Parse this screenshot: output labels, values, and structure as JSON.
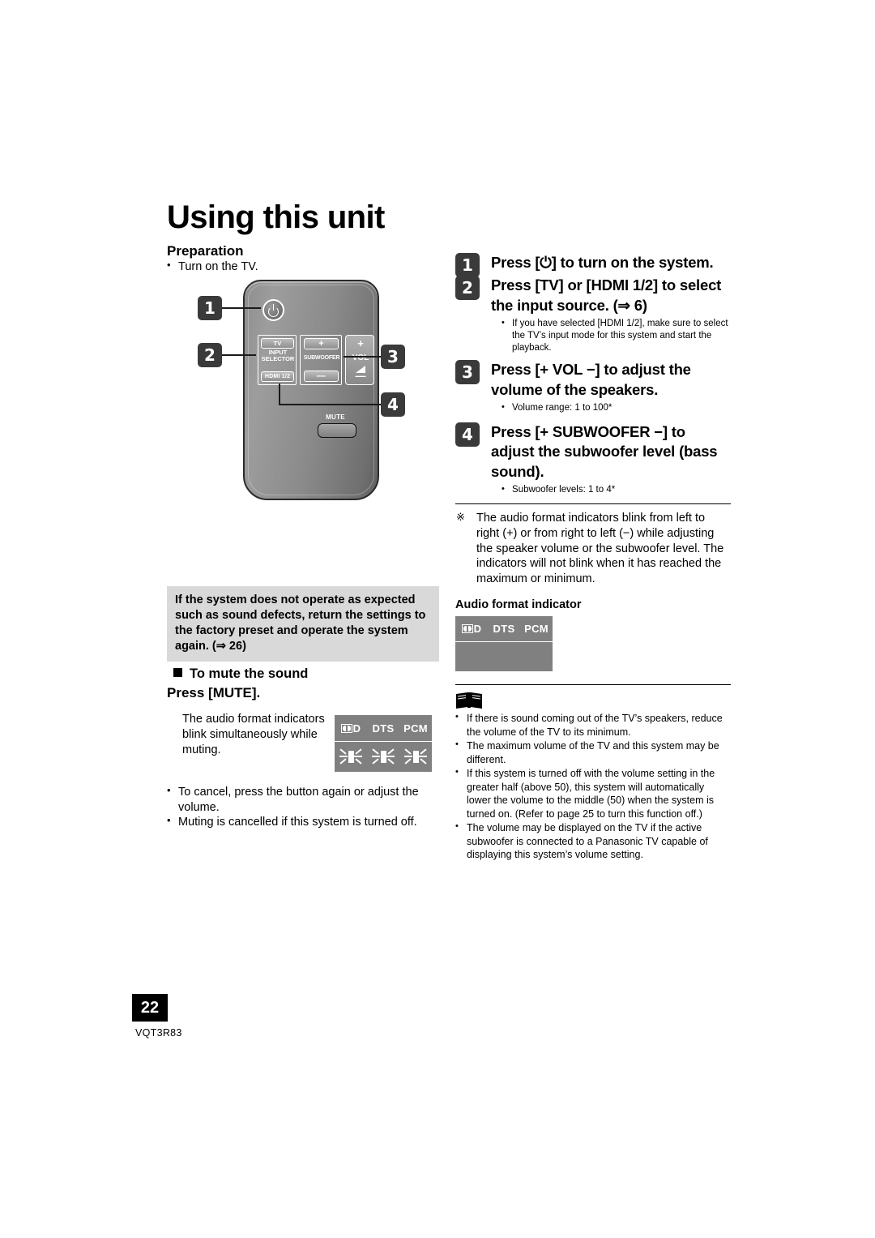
{
  "page": {
    "title": "Using this unit",
    "page_number": "22",
    "doc_code": "VQT3R83"
  },
  "left": {
    "preparation_heading": "Preparation",
    "preparation_bullet": "Turn on the TV.",
    "notice_box": "If the system does not operate as expected such as sound defects, return the settings to the factory preset and operate the system again. (⇒ 26)",
    "mute_heading": "To mute the sound",
    "mute_press": "Press [MUTE].",
    "mute_description": "The audio format indicators blink simultaneously while muting.",
    "mute_bullets": [
      "To cancel, press the button again or adjust the volume.",
      "Muting is cancelled if this system is turned off."
    ]
  },
  "remote": {
    "power_label": "power-icon",
    "tv_button": "TV",
    "input_selector_line1": "INPUT",
    "input_selector_line2": "SELECTOR",
    "hdmi_button": "HDMI 1/2",
    "subwoofer_plus": "+",
    "subwoofer_label": "SUBWOOFER",
    "subwoofer_minus": "—",
    "vol_plus": "+",
    "vol_label": "VOL",
    "vol_minus": "—",
    "mute_label": "MUTE",
    "callouts": [
      "1",
      "2",
      "3",
      "4"
    ]
  },
  "steps": [
    {
      "num": "1",
      "text": "Press [⏻] to turn on the system.",
      "bullets": []
    },
    {
      "num": "2",
      "text": "Press [TV] or [HDMI 1/2] to select the input source. (⇒ 6)",
      "bullets": [
        "If you have selected [HDMI 1/2], make sure to select the TV’s input mode for this system and start the playback."
      ]
    },
    {
      "num": "3",
      "text": "Press [+ VOL −] to adjust the volume of the speakers.",
      "bullets": [
        "Volume range: 1 to 100*"
      ]
    },
    {
      "num": "4",
      "text": "Press [+ SUBWOOFER −] to adjust the subwoofer level (bass sound).",
      "bullets": [
        "Subwoofer levels: 1 to 4*"
      ]
    }
  ],
  "right": {
    "star_note": "The audio format indicators blink from left to right (+) or from right to left (−) while adjusting the speaker volume or the subwoofer level. The indicators will not blink when it has reached the maximum or minimum.",
    "afi_title": "Audio format indicator",
    "notes": [
      "If there is sound coming out of the TV’s speakers, reduce the volume of the TV to its minimum.",
      "The maximum volume of the TV and this system may be different.",
      "If this system is turned off with the volume setting in the greater half (above 50), this system will automatically lower the volume to the middle (50) when the system is turned on. (Refer to page 25 to turn this function off.)",
      "The volume may be displayed on the TV if the active subwoofer is connected to a Panasonic TV capable of displaying this system’s volume setting."
    ]
  },
  "indicators": {
    "labels": [
      "DOLBY D",
      "DTS",
      "PCM"
    ],
    "dts": "DTS",
    "pcm": "PCM"
  },
  "colors": {
    "callout_bg": "#3a3a3a",
    "notice_bg": "#d9d9d9",
    "indicator_bg": "#808080",
    "page_num_bg": "#000000"
  }
}
